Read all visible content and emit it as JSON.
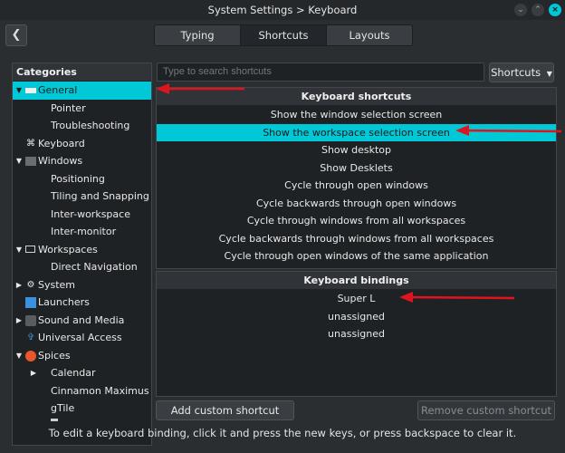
{
  "window": {
    "title": "System Settings > Keyboard"
  },
  "toolbar": {
    "back_icon": "back-arrow-icon",
    "tabs": [
      {
        "label": "Typing",
        "active": false
      },
      {
        "label": "Shortcuts",
        "active": true
      },
      {
        "label": "Layouts",
        "active": false
      }
    ]
  },
  "categories": {
    "header": "Categories",
    "items": [
      {
        "label": "General",
        "expanded": true,
        "selected": true
      },
      {
        "label": "Pointer"
      },
      {
        "label": "Troubleshooting"
      },
      {
        "label": "Keyboard"
      },
      {
        "label": "Windows",
        "expanded": true
      },
      {
        "label": "Positioning"
      },
      {
        "label": "Tiling and Snapping"
      },
      {
        "label": "Inter-workspace"
      },
      {
        "label": "Inter-monitor"
      },
      {
        "label": "Workspaces",
        "expanded": true
      },
      {
        "label": "Direct Navigation"
      },
      {
        "label": "System",
        "expanded": false
      },
      {
        "label": "Launchers"
      },
      {
        "label": "Sound and Media",
        "expanded": false
      },
      {
        "label": "Universal Access"
      },
      {
        "label": "Spices",
        "expanded": true
      },
      {
        "label": "Calendar",
        "expanded": false
      },
      {
        "label": "Cinnamon Maximus"
      },
      {
        "label": "gTile"
      }
    ]
  },
  "search": {
    "placeholder": "Type to search shortcuts"
  },
  "filter_dropdown": {
    "label": "Shortcuts"
  },
  "shortcuts": {
    "header": "Keyboard shortcuts",
    "items": [
      "Show the window selection screen",
      "Show the workspace selection screen",
      "Show desktop",
      "Show Desklets",
      "Cycle through open windows",
      "Cycle backwards through open windows",
      "Cycle through windows from all workspaces",
      "Cycle backwards through windows from all workspaces",
      "Cycle through open windows of the same application"
    ],
    "selected_index": 1
  },
  "bindings": {
    "header": "Keyboard bindings",
    "items": [
      "Super L",
      "unassigned",
      "unassigned"
    ]
  },
  "buttons": {
    "add": "Add custom shortcut",
    "remove": "Remove custom shortcut"
  },
  "hint": "To edit a keyboard binding, click it and press the new keys, or press backspace to clear it.",
  "colors": {
    "accent": "#00c8d7",
    "annotation_arrow": "#e0141e"
  }
}
